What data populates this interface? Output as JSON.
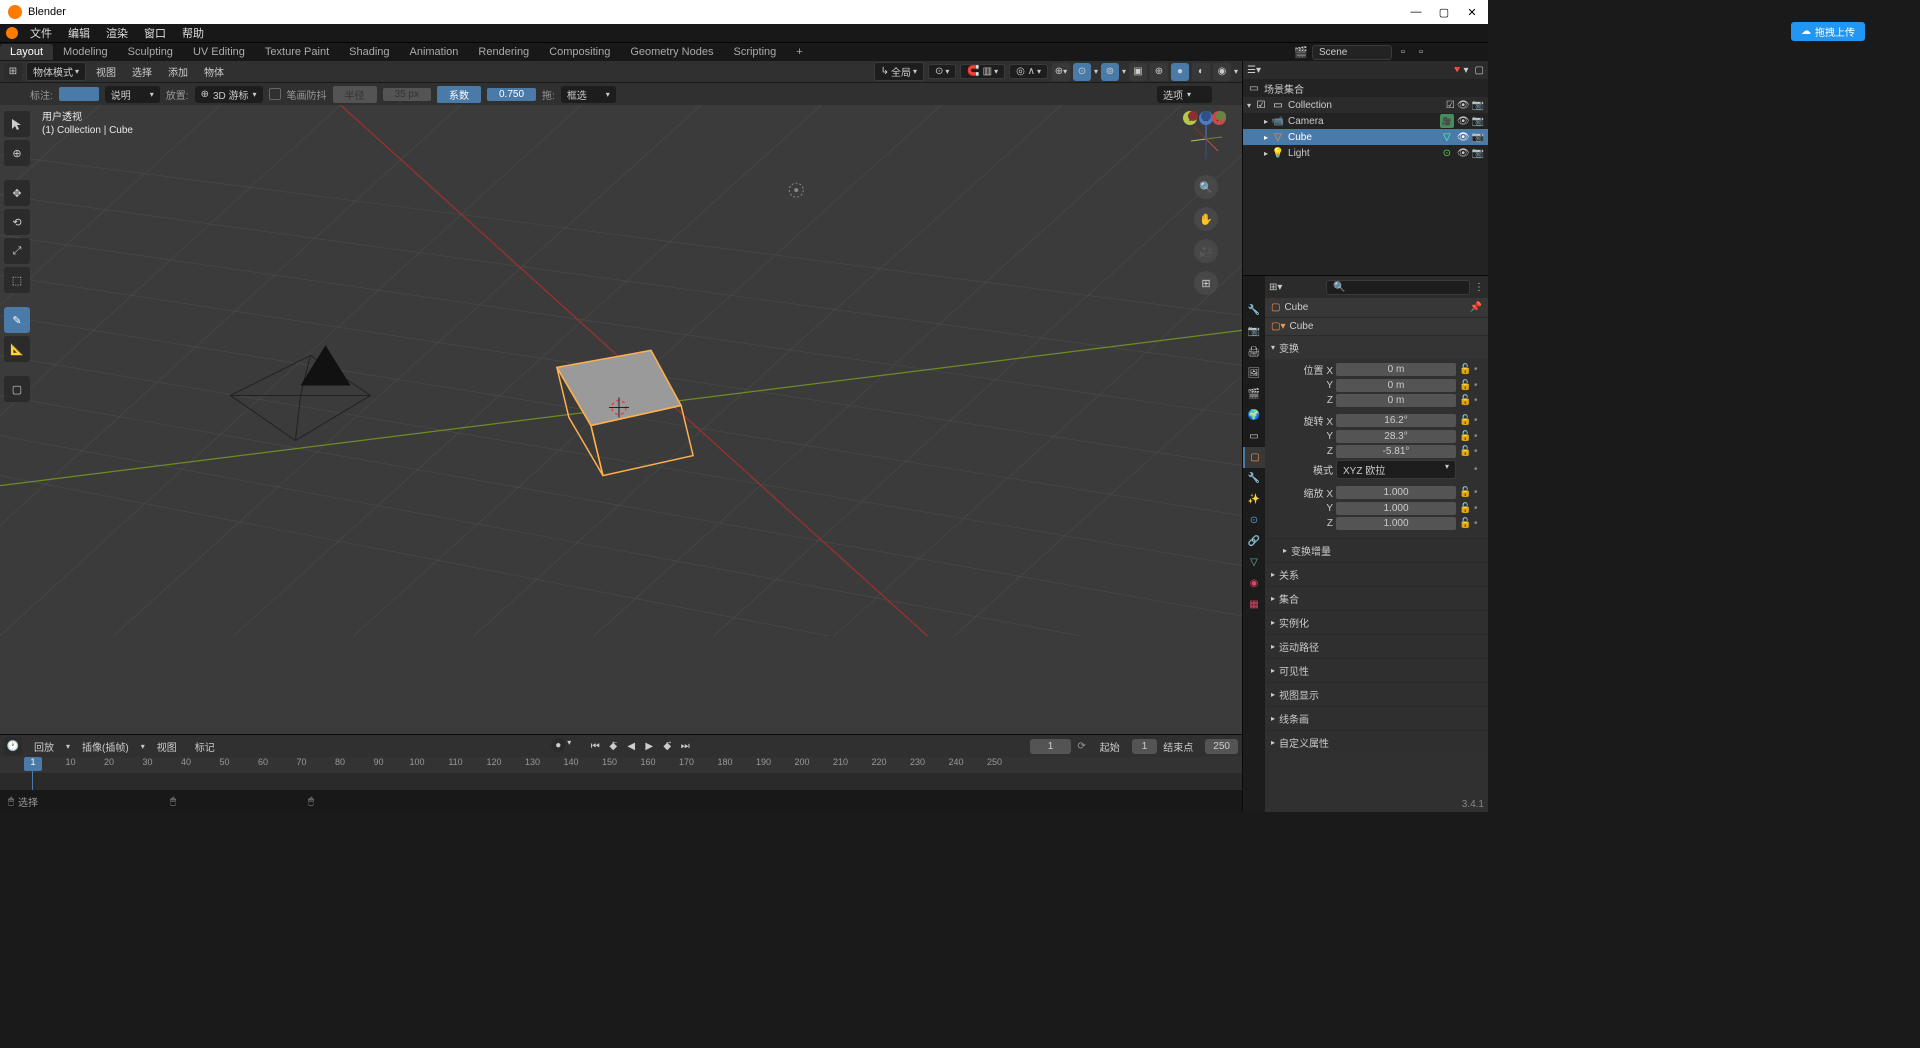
{
  "app": {
    "title": "Blender"
  },
  "upload": "拖拽上传",
  "menu": [
    "文件",
    "编辑",
    "渲染",
    "窗口",
    "帮助"
  ],
  "tabs": [
    "Layout",
    "Modeling",
    "Sculpting",
    "UV Editing",
    "Texture Paint",
    "Shading",
    "Animation",
    "Rendering",
    "Compositing",
    "Geometry Nodes",
    "Scripting"
  ],
  "scene": {
    "iconLabel": "Scene",
    "name": "Scene"
  },
  "viewport": {
    "mode": "物体模式",
    "menus": [
      "视图",
      "选择",
      "添加",
      "物体"
    ],
    "globalLabel": "全局",
    "overlay_title1": "用户透视",
    "overlay_title2": "(1) Collection | Cube",
    "options_label": "选项"
  },
  "secondary": {
    "label": "标注:",
    "desc": "说明",
    "place": "放置:",
    "placeValue": "3D 游标",
    "pen": "笔画防抖",
    "radius": "半径",
    "radiusVal": "35 px",
    "series": "系数",
    "seriesVal": "0.750",
    "drag": "拖:",
    "select": "框选"
  },
  "outliner": {
    "title": "场景集合",
    "collection": "Collection",
    "items": [
      {
        "name": "Camera"
      },
      {
        "name": "Cube"
      },
      {
        "name": "Light"
      }
    ]
  },
  "properties": {
    "crumb1": "Cube",
    "crumb2": "Cube",
    "transform_title": "变换",
    "mode_label": "模式",
    "mode_value": "XYZ 欧拉",
    "rows": {
      "posX": {
        "label": "位置 X",
        "val": "0 m"
      },
      "posY": {
        "label": "Y",
        "val": "0 m"
      },
      "posZ": {
        "label": "Z",
        "val": "0 m"
      },
      "rotX": {
        "label": "旋转 X",
        "val": "16.2°"
      },
      "rotY": {
        "label": "Y",
        "val": "28.3°"
      },
      "rotZ": {
        "label": "Z",
        "val": "-5.81°"
      },
      "sclX": {
        "label": "缩放 X",
        "val": "1.000"
      },
      "sclY": {
        "label": "Y",
        "val": "1.000"
      },
      "sclZ": {
        "label": "Z",
        "val": "1.000"
      }
    },
    "sections": [
      "变换增量",
      "关系",
      "集合",
      "实例化",
      "运动路径",
      "可见性",
      "视图显示",
      "线条画",
      "自定义属性"
    ]
  },
  "timeline": {
    "playback": "回放",
    "keying": "插像(插帧)",
    "view": "视图",
    "marker": "标记",
    "current": "1",
    "start_label": "起始",
    "start": "1",
    "end_label": "结束点",
    "end": "250",
    "ticks": [
      "1",
      "",
      "20",
      "",
      "40",
      "",
      "60",
      "",
      "80",
      "",
      "100",
      "",
      "120",
      "",
      "140",
      "",
      "160",
      "",
      "180",
      "",
      "200",
      "",
      "220",
      "",
      "240",
      ""
    ],
    "tickAll": [
      1,
      10,
      20,
      30,
      40,
      50,
      60,
      70,
      80,
      90,
      100,
      110,
      120,
      130,
      140,
      150,
      160,
      170,
      180,
      190,
      200,
      210,
      220,
      230,
      240,
      250
    ]
  },
  "status": {
    "select": "选择"
  },
  "version": "3.4.1"
}
